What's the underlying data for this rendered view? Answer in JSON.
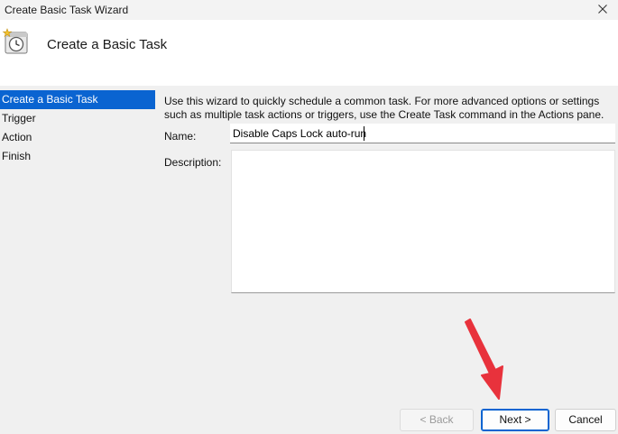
{
  "window": {
    "title": "Create Basic Task Wizard"
  },
  "header": {
    "title": "Create a Basic Task"
  },
  "steps": [
    {
      "label": "Create a Basic Task",
      "active": true
    },
    {
      "label": "Trigger",
      "active": false
    },
    {
      "label": "Action",
      "active": false
    },
    {
      "label": "Finish",
      "active": false
    }
  ],
  "intro": {
    "line1": "Use this wizard to quickly schedule a common task.  For more advanced options or settings",
    "line2": "such as multiple task actions or triggers, use the Create Task command in the Actions pane."
  },
  "form": {
    "name_label": "Name:",
    "name_value": "Disable Caps Lock auto-run",
    "description_label": "Description:",
    "description_value": ""
  },
  "buttons": {
    "back": "< Back",
    "next": "Next >",
    "cancel": "Cancel"
  },
  "colors": {
    "accent": "#0a64d1",
    "annotation_arrow": "#e8323c"
  },
  "icons": {
    "close": "close-icon",
    "task": "task-scheduler-clock-icon"
  }
}
